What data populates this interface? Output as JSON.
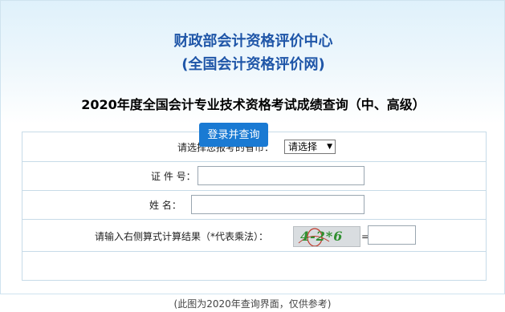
{
  "header": {
    "org_line1": "财政部会计资格评价中心",
    "org_line2": "(全国会计资格评价网)",
    "query_title": "2020年度全国会计专业技术资格考试成绩查询（中、高级）"
  },
  "form": {
    "province": {
      "label": "请选择您报考的省市：",
      "selected": "请选择"
    },
    "id_number": {
      "label": "证 件 号：",
      "value": ""
    },
    "name": {
      "label": "姓  名：",
      "value": ""
    },
    "captcha": {
      "label": "请输入右侧算式计算结果（*代表乘法）：",
      "expression": "4-2*6",
      "equals": "=",
      "answer": ""
    },
    "submit_label": "登录并查询"
  },
  "caption": "(此图为2020年查询界面，仅供参考)",
  "colors": {
    "title_blue": "#1f56a8",
    "button_blue": "#1a7ad3",
    "captcha_green": "#2f8f2f"
  }
}
